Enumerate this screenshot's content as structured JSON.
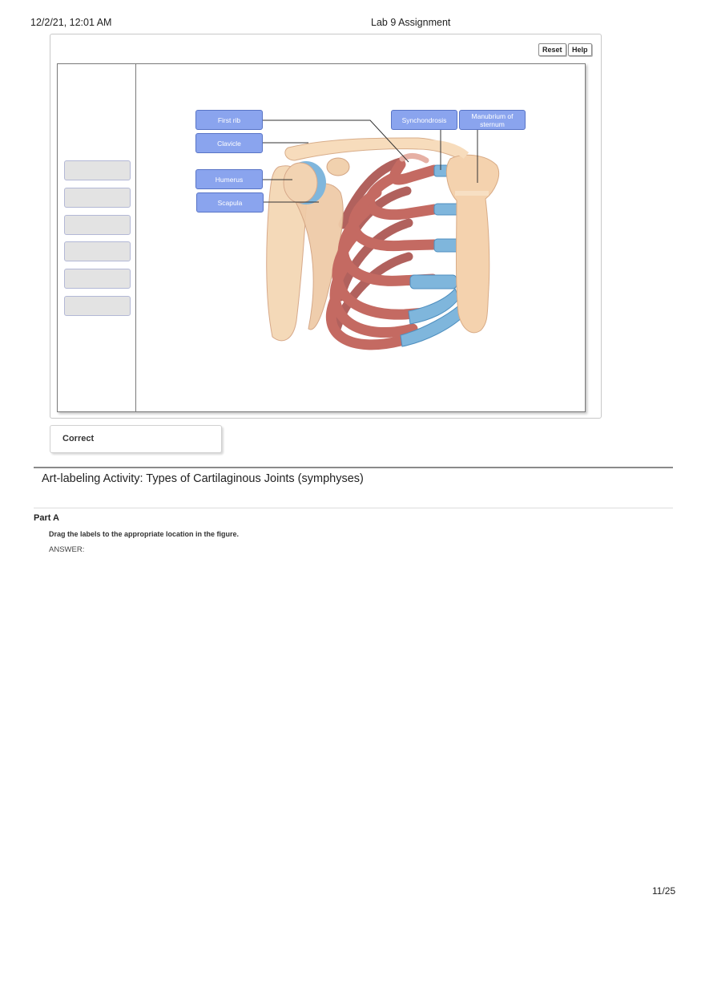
{
  "header": {
    "datetime": "12/2/21, 12:01 AM",
    "doc_title": "Lab 9 Assignment"
  },
  "toolbar": {
    "reset_label": "Reset",
    "help_label": "Help"
  },
  "label_bank": {
    "empty_slot_count": 6
  },
  "figure": {
    "labels": {
      "first_rib": "First rib",
      "clavicle": "Clavicle",
      "humerus": "Humerus",
      "scapula": "Scapula",
      "synchondrosis": "Synchondrosis",
      "manubrium": "Manubrium of sternum"
    },
    "colors": {
      "label_fill": "#8aa4ee",
      "cartilage": "#7fb6dc",
      "bone": "#f4d2ae",
      "rib": "#c46a62"
    }
  },
  "feedback": {
    "status": "Correct"
  },
  "section": {
    "title": "Art-labeling Activity: Types of Cartilaginous Joints (symphyses)",
    "part_label": "Part A",
    "instruction": "Drag the labels to the appropriate location in the figure.",
    "answer_label": "ANSWER:"
  },
  "footer": {
    "page_indicator": "11/25"
  }
}
